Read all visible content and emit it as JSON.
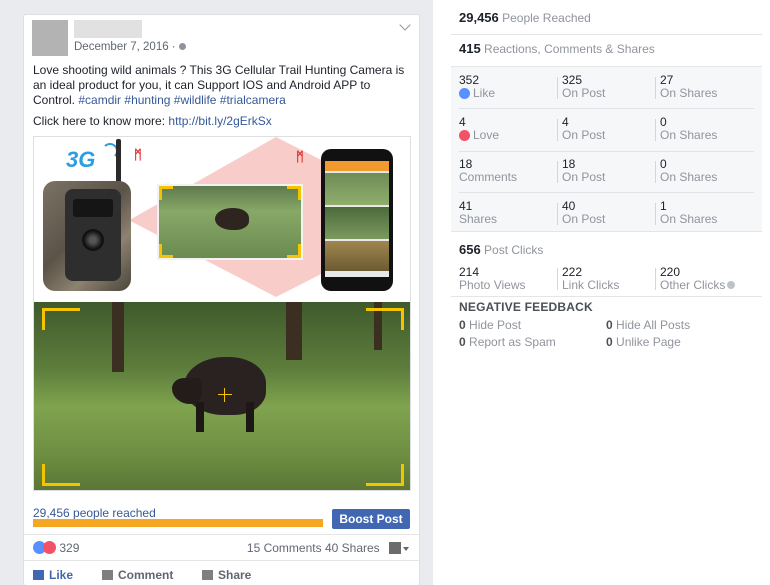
{
  "post": {
    "date": "December 7, 2016 ·",
    "text_prefix": "Love shooting wild animals ? This 3G Cellular Trail Hunting Camera is an ideal product for you, it can Support IOS and Android APP to Control.",
    "hashtags": "#camdir #hunting #wildlife #trialcamera",
    "more_prefix": "Click here to know more:",
    "link": "http://bit.ly/2gErkSx",
    "ad_badge": "3G",
    "reach_text": "29,456 people reached",
    "reach_fraction": 1.0,
    "boost_label": "Boost Post",
    "reaction_count": "329",
    "comments": "15 Comments",
    "shares": "40 Shares",
    "actions": {
      "like": "Like",
      "comment": "Comment",
      "share": "Share"
    }
  },
  "insights": {
    "people_reached": {
      "value": "29,456",
      "label": "People Reached"
    },
    "engagement": {
      "value": "415",
      "label": "Reactions, Comments & Shares"
    },
    "rows": [
      {
        "total": "352",
        "total_label": "Like",
        "on_post": "325",
        "on_post_label": "On Post",
        "on_shares": "27",
        "on_shares_label": "On Shares"
      },
      {
        "total": "4",
        "total_label": "Love",
        "on_post": "4",
        "on_post_label": "On Post",
        "on_shares": "0",
        "on_shares_label": "On Shares"
      },
      {
        "total": "18",
        "total_label": "Comments",
        "on_post": "18",
        "on_post_label": "On Post",
        "on_shares": "0",
        "on_shares_label": "On Shares"
      },
      {
        "total": "41",
        "total_label": "Shares",
        "on_post": "40",
        "on_post_label": "On Post",
        "on_shares": "1",
        "on_shares_label": "On Shares"
      }
    ],
    "post_clicks": {
      "value": "656",
      "label": "Post Clicks"
    },
    "clicks": [
      {
        "value": "214",
        "label": "Photo Views"
      },
      {
        "value": "222",
        "label": "Link Clicks"
      },
      {
        "value": "220",
        "label": "Other Clicks"
      }
    ],
    "negative": {
      "title": "NEGATIVE FEEDBACK",
      "items": [
        {
          "value": "0",
          "label": "Hide Post"
        },
        {
          "value": "0",
          "label": "Hide All Posts"
        },
        {
          "value": "0",
          "label": "Report as Spam"
        },
        {
          "value": "0",
          "label": "Unlike Page"
        }
      ]
    }
  },
  "icons": {
    "like": "like-icon",
    "love": "love-icon",
    "globe": "globe-icon",
    "info": "info-icon",
    "comment": "comment-icon",
    "share": "share-icon"
  },
  "colors": {
    "link": "#365899",
    "boost": "#4267b2",
    "reach_bar": "#f5a623",
    "like": "#5890ff",
    "love": "#f25268"
  }
}
